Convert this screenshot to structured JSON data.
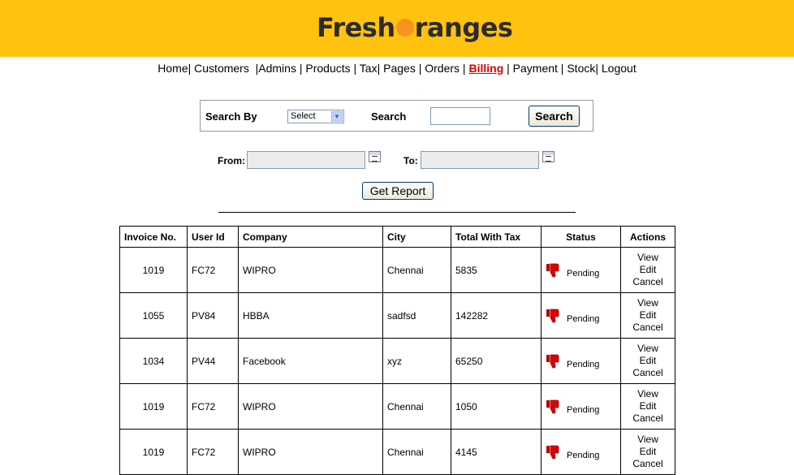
{
  "app": {
    "logo_left": "Fresh",
    "logo_right": "ranges"
  },
  "nav": [
    {
      "label": "Home",
      "active": false
    },
    {
      "label": "Customers",
      "active": false
    },
    {
      "label": "Admins",
      "active": false
    },
    {
      "label": "Products",
      "active": false
    },
    {
      "label": "Tax",
      "active": false
    },
    {
      "label": "Pages",
      "active": false
    },
    {
      "label": "Orders",
      "active": false
    },
    {
      "label": "Billing",
      "active": true
    },
    {
      "label": "Payment",
      "active": false
    },
    {
      "label": "Stock",
      "active": false
    },
    {
      "label": "Logout",
      "active": false
    }
  ],
  "search": {
    "by_label": "Search By",
    "select_value": "Select",
    "search_label": "Search",
    "input_value": "",
    "button_label": "Search"
  },
  "date_filter": {
    "from_label": "From:",
    "from_value": "",
    "to_label": "To:",
    "to_value": "",
    "report_button": "Get Report"
  },
  "table": {
    "headers": [
      "Invoice No.",
      "User Id",
      "Company",
      "City",
      "Total With Tax",
      "Status",
      "Actions"
    ],
    "rows": [
      {
        "invoice": "1019",
        "user_id": "FC72",
        "company": "WIPRO",
        "city": "Chennai",
        "total": "5835",
        "status": "Pending"
      },
      {
        "invoice": "1055",
        "user_id": "PV84",
        "company": "HBBA",
        "city": "sadfsd",
        "total": "142282",
        "status": "Pending"
      },
      {
        "invoice": "1034",
        "user_id": "PV44",
        "company": "Facebook",
        "city": "xyz",
        "total": "65250",
        "status": "Pending"
      },
      {
        "invoice": "1019",
        "user_id": "FC72",
        "company": "WIPRO",
        "city": "Chennai",
        "total": "1050",
        "status": "Pending"
      },
      {
        "invoice": "1019",
        "user_id": "FC72",
        "company": "WIPRO",
        "city": "Chennai",
        "total": "4145",
        "status": "Pending"
      }
    ],
    "actions": [
      "View",
      "Edit",
      "Cancel"
    ],
    "status_icon": "thumbs-down-icon"
  },
  "colors": {
    "header_bg": "#ffc20e",
    "logo_dot": "#f7941d",
    "active_link": "#e00000",
    "status_icon": "#e00000"
  }
}
